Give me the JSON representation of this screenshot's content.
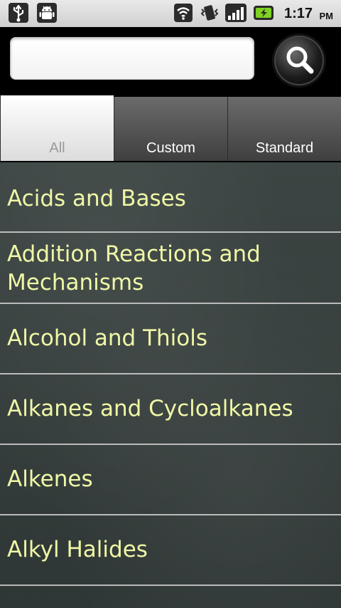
{
  "status_bar": {
    "time": "1:17",
    "ampm": "PM",
    "icons": [
      "usb-icon",
      "android-debug-icon",
      "wifi-icon",
      "vibrate-icon",
      "signal-icon",
      "battery-charging-icon"
    ]
  },
  "search": {
    "value": "",
    "placeholder": ""
  },
  "tabs": [
    {
      "label": "All",
      "active": true
    },
    {
      "label": "Custom",
      "active": false
    },
    {
      "label": "Standard",
      "active": false
    }
  ],
  "list": {
    "items": [
      {
        "label": "Acids and Bases"
      },
      {
        "label": "Addition Reactions and Mechanisms"
      },
      {
        "label": "Alcohol and Thiols"
      },
      {
        "label": "Alkanes and Cycloalkanes"
      },
      {
        "label": "Alkenes"
      },
      {
        "label": "Alkyl Halides"
      }
    ]
  },
  "colors": {
    "list_text": "#f0f7a6",
    "list_background": "#333b3a",
    "divider": "#c9c9c9",
    "status_bar": "#dcdcdc",
    "tab_active": "#ffffff",
    "tab_inactive": "#5a5a5a"
  }
}
